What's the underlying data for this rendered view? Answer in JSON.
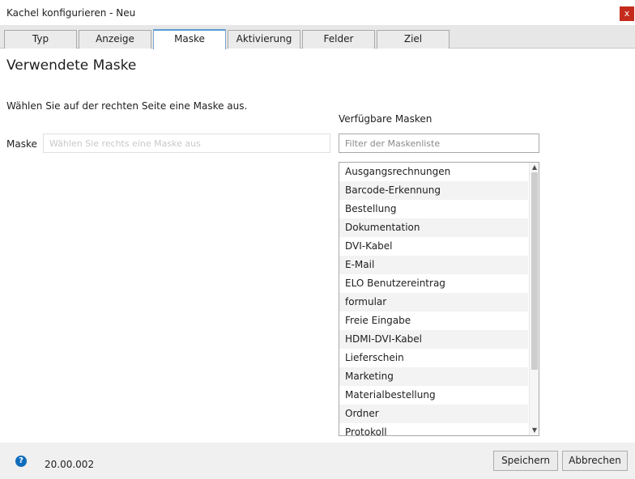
{
  "window": {
    "title": "Kachel konfigurieren - Neu",
    "close_label": "x"
  },
  "tabs": [
    {
      "label": "Typ"
    },
    {
      "label": "Anzeige"
    },
    {
      "label": "Maske"
    },
    {
      "label": "Aktivierung"
    },
    {
      "label": "Felder"
    },
    {
      "label": "Ziel"
    }
  ],
  "active_tab": "Maske",
  "main": {
    "heading": "Verwendete Maske",
    "hint": "Wählen Sie auf der rechten Seite eine Maske aus.",
    "maske_label": "Maske",
    "maske_placeholder": "Wählen Sie rechts eine Maske aus",
    "maske_value": ""
  },
  "available": {
    "label": "Verfügbare Masken",
    "filter_placeholder": "Filter der Maskenliste",
    "items": [
      "Ausgangsrechnungen",
      "Barcode-Erkennung",
      "Bestellung",
      "Dokumentation",
      "DVI-Kabel",
      "E-Mail",
      "ELO Benutzereintrag",
      "formular",
      "Freie Eingabe",
      "HDMI-DVI-Kabel",
      "Lieferschein",
      "Marketing",
      "Materialbestellung",
      "Ordner",
      "Protokoll"
    ]
  },
  "scrollbar": {
    "up_icon": "▲",
    "down_icon": "▼"
  },
  "footer": {
    "help_icon": "?",
    "version": "20.00.002",
    "save_label": "Speichern",
    "cancel_label": "Abbrechen"
  },
  "colors": {
    "close_button": "#c42b1c",
    "help_icon": "#0f6cbd",
    "active_tab_accent": "#5b9bd5"
  }
}
